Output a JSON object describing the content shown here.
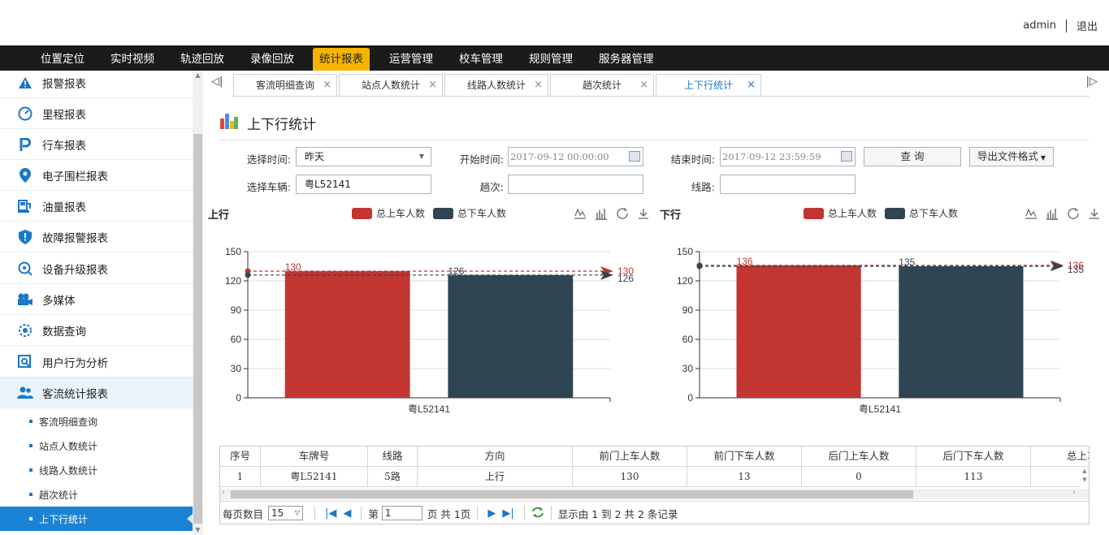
{
  "header": {
    "user": "admin",
    "logout": "退出"
  },
  "nav": [
    {
      "label": "位置定位"
    },
    {
      "label": "实时视频"
    },
    {
      "label": "轨迹回放"
    },
    {
      "label": "录像回放"
    },
    {
      "label": "统计报表",
      "active": true
    },
    {
      "label": "运营管理"
    },
    {
      "label": "校车管理"
    },
    {
      "label": "规则管理"
    },
    {
      "label": "服务器管理"
    }
  ],
  "sidebar": {
    "items": [
      {
        "label": "报警报表",
        "icon": "warning-icon"
      },
      {
        "label": "里程报表",
        "icon": "speedometer-icon"
      },
      {
        "label": "行车报表",
        "icon": "parking-icon"
      },
      {
        "label": "电子围栏报表",
        "icon": "location-pin-icon"
      },
      {
        "label": "油量报表",
        "icon": "fuel-pump-icon"
      },
      {
        "label": "故障报警报表",
        "icon": "shield-alert-icon"
      },
      {
        "label": "设备升级报表",
        "icon": "upgrade-icon"
      },
      {
        "label": "多媒体",
        "icon": "camera-icon"
      },
      {
        "label": "数据查询",
        "icon": "data-query-icon"
      },
      {
        "label": "用户行为分析",
        "icon": "analysis-icon"
      },
      {
        "label": "客流统计报表",
        "icon": "users-icon"
      }
    ],
    "subitems": [
      {
        "label": "客流明细查询"
      },
      {
        "label": "站点人数统计"
      },
      {
        "label": "线路人数统计"
      },
      {
        "label": "趟次统计"
      },
      {
        "label": "上下行统计",
        "active": true
      }
    ]
  },
  "tabs": [
    {
      "label": "客流明细查询"
    },
    {
      "label": "站点人数统计"
    },
    {
      "label": "线路人数统计"
    },
    {
      "label": "趟次统计"
    },
    {
      "label": "上下行统计",
      "active": true
    }
  ],
  "page": {
    "title": "上下行统计"
  },
  "filters": {
    "time_label": "选择时间:",
    "time_value": "昨天",
    "start_label": "开始时间:",
    "start_value": "2017-09-12 00:00:00",
    "end_label": "结束时间:",
    "end_value": "2017-09-12 23:59:59",
    "query_button": "查 询",
    "export_button": "导出文件格式",
    "vehicle_label": "选择车辆:",
    "vehicle_value": "粤L52141",
    "trip_label": "趟次:",
    "trip_value": "",
    "route_label": "线路:",
    "route_value": ""
  },
  "colors": {
    "boarding": "#c23531",
    "alighting": "#2f4554",
    "accent": "#1a83d6",
    "nav_active": "#f6b400"
  },
  "chart_data": [
    {
      "type": "bar",
      "title": "上行",
      "categories": [
        "粤L52141"
      ],
      "series": [
        {
          "name": "总上车人数",
          "values": [
            130
          ],
          "color": "#c23531",
          "average": 130
        },
        {
          "name": "总下车人数",
          "values": [
            126
          ],
          "color": "#2f4554",
          "average": 126
        }
      ],
      "ylim": [
        0,
        150
      ],
      "yticks": [
        0,
        30,
        60,
        90,
        120,
        150
      ],
      "legend": "top-center",
      "grid": true
    },
    {
      "type": "bar",
      "title": "下行",
      "categories": [
        "粤L52141"
      ],
      "series": [
        {
          "name": "总上车人数",
          "values": [
            136
          ],
          "color": "#c23531",
          "average": 136
        },
        {
          "name": "总下车人数",
          "values": [
            135
          ],
          "color": "#2f4554",
          "average": 135
        }
      ],
      "ylim": [
        0,
        150
      ],
      "yticks": [
        0,
        30,
        60,
        90,
        120,
        150
      ],
      "legend": "top-center",
      "grid": true
    }
  ],
  "table": {
    "columns": [
      "序号",
      "车牌号",
      "线路",
      "方向",
      "前门上车人数",
      "前门下车人数",
      "后门上车人数",
      "后门下车人数",
      "总上车人数"
    ],
    "rows": [
      [
        "1",
        "粤L52141",
        "5路",
        "上行",
        "130",
        "13",
        "0",
        "113",
        ""
      ]
    ]
  },
  "pager": {
    "page_size_label": "每页数目",
    "page_size": "15",
    "page_prefix": "第",
    "page_value": "1",
    "page_suffix": "页 共 1页",
    "summary": "显示由 1 到 2 共 2 条记录"
  }
}
